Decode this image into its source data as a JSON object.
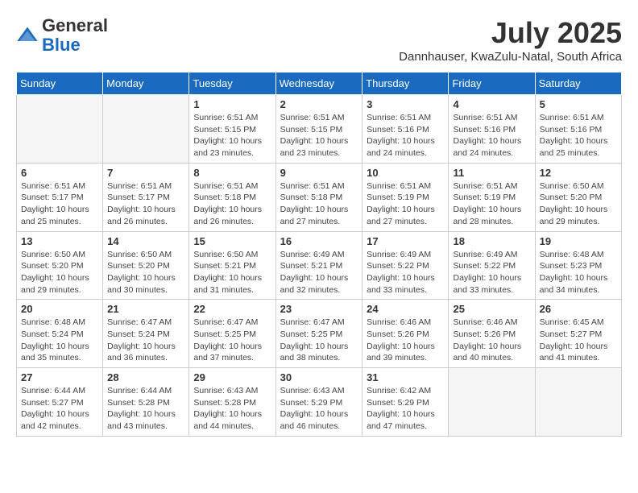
{
  "header": {
    "logo_general": "General",
    "logo_blue": "Blue",
    "month_title": "July 2025",
    "location": "Dannhauser, KwaZulu-Natal, South Africa"
  },
  "weekdays": [
    "Sunday",
    "Monday",
    "Tuesday",
    "Wednesday",
    "Thursday",
    "Friday",
    "Saturday"
  ],
  "weeks": [
    [
      {
        "day": "",
        "info": ""
      },
      {
        "day": "",
        "info": ""
      },
      {
        "day": "1",
        "info": "Sunrise: 6:51 AM\nSunset: 5:15 PM\nDaylight: 10 hours and 23 minutes."
      },
      {
        "day": "2",
        "info": "Sunrise: 6:51 AM\nSunset: 5:15 PM\nDaylight: 10 hours and 23 minutes."
      },
      {
        "day": "3",
        "info": "Sunrise: 6:51 AM\nSunset: 5:16 PM\nDaylight: 10 hours and 24 minutes."
      },
      {
        "day": "4",
        "info": "Sunrise: 6:51 AM\nSunset: 5:16 PM\nDaylight: 10 hours and 24 minutes."
      },
      {
        "day": "5",
        "info": "Sunrise: 6:51 AM\nSunset: 5:16 PM\nDaylight: 10 hours and 25 minutes."
      }
    ],
    [
      {
        "day": "6",
        "info": "Sunrise: 6:51 AM\nSunset: 5:17 PM\nDaylight: 10 hours and 25 minutes."
      },
      {
        "day": "7",
        "info": "Sunrise: 6:51 AM\nSunset: 5:17 PM\nDaylight: 10 hours and 26 minutes."
      },
      {
        "day": "8",
        "info": "Sunrise: 6:51 AM\nSunset: 5:18 PM\nDaylight: 10 hours and 26 minutes."
      },
      {
        "day": "9",
        "info": "Sunrise: 6:51 AM\nSunset: 5:18 PM\nDaylight: 10 hours and 27 minutes."
      },
      {
        "day": "10",
        "info": "Sunrise: 6:51 AM\nSunset: 5:19 PM\nDaylight: 10 hours and 27 minutes."
      },
      {
        "day": "11",
        "info": "Sunrise: 6:51 AM\nSunset: 5:19 PM\nDaylight: 10 hours and 28 minutes."
      },
      {
        "day": "12",
        "info": "Sunrise: 6:50 AM\nSunset: 5:20 PM\nDaylight: 10 hours and 29 minutes."
      }
    ],
    [
      {
        "day": "13",
        "info": "Sunrise: 6:50 AM\nSunset: 5:20 PM\nDaylight: 10 hours and 29 minutes."
      },
      {
        "day": "14",
        "info": "Sunrise: 6:50 AM\nSunset: 5:20 PM\nDaylight: 10 hours and 30 minutes."
      },
      {
        "day": "15",
        "info": "Sunrise: 6:50 AM\nSunset: 5:21 PM\nDaylight: 10 hours and 31 minutes."
      },
      {
        "day": "16",
        "info": "Sunrise: 6:49 AM\nSunset: 5:21 PM\nDaylight: 10 hours and 32 minutes."
      },
      {
        "day": "17",
        "info": "Sunrise: 6:49 AM\nSunset: 5:22 PM\nDaylight: 10 hours and 33 minutes."
      },
      {
        "day": "18",
        "info": "Sunrise: 6:49 AM\nSunset: 5:22 PM\nDaylight: 10 hours and 33 minutes."
      },
      {
        "day": "19",
        "info": "Sunrise: 6:48 AM\nSunset: 5:23 PM\nDaylight: 10 hours and 34 minutes."
      }
    ],
    [
      {
        "day": "20",
        "info": "Sunrise: 6:48 AM\nSunset: 5:24 PM\nDaylight: 10 hours and 35 minutes."
      },
      {
        "day": "21",
        "info": "Sunrise: 6:47 AM\nSunset: 5:24 PM\nDaylight: 10 hours and 36 minutes."
      },
      {
        "day": "22",
        "info": "Sunrise: 6:47 AM\nSunset: 5:25 PM\nDaylight: 10 hours and 37 minutes."
      },
      {
        "day": "23",
        "info": "Sunrise: 6:47 AM\nSunset: 5:25 PM\nDaylight: 10 hours and 38 minutes."
      },
      {
        "day": "24",
        "info": "Sunrise: 6:46 AM\nSunset: 5:26 PM\nDaylight: 10 hours and 39 minutes."
      },
      {
        "day": "25",
        "info": "Sunrise: 6:46 AM\nSunset: 5:26 PM\nDaylight: 10 hours and 40 minutes."
      },
      {
        "day": "26",
        "info": "Sunrise: 6:45 AM\nSunset: 5:27 PM\nDaylight: 10 hours and 41 minutes."
      }
    ],
    [
      {
        "day": "27",
        "info": "Sunrise: 6:44 AM\nSunset: 5:27 PM\nDaylight: 10 hours and 42 minutes."
      },
      {
        "day": "28",
        "info": "Sunrise: 6:44 AM\nSunset: 5:28 PM\nDaylight: 10 hours and 43 minutes."
      },
      {
        "day": "29",
        "info": "Sunrise: 6:43 AM\nSunset: 5:28 PM\nDaylight: 10 hours and 44 minutes."
      },
      {
        "day": "30",
        "info": "Sunrise: 6:43 AM\nSunset: 5:29 PM\nDaylight: 10 hours and 46 minutes."
      },
      {
        "day": "31",
        "info": "Sunrise: 6:42 AM\nSunset: 5:29 PM\nDaylight: 10 hours and 47 minutes."
      },
      {
        "day": "",
        "info": ""
      },
      {
        "day": "",
        "info": ""
      }
    ]
  ]
}
